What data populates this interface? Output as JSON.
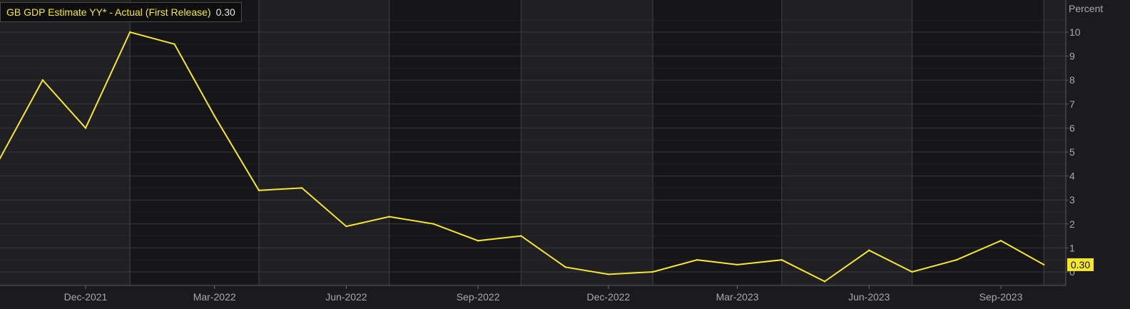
{
  "legend": {
    "series_label": "GB GDP Estimate YY* - Actual (First Release)",
    "last_value": "0.30"
  },
  "colors": {
    "background": "#1b1b1d",
    "band_light": "#202022",
    "band_dark": "#161618",
    "gridline": "#3a3a3d",
    "axis_text": "#a9a9ad",
    "series": "#f5e636"
  },
  "chart_data": {
    "type": "line",
    "title": "",
    "xlabel": "",
    "ylabel": "Percent",
    "ylim": [
      -0.7,
      11
    ],
    "y_ticks": [
      {
        "value": 10,
        "label": "10"
      },
      {
        "value": 9,
        "label": "9"
      },
      {
        "value": 8,
        "label": "8"
      },
      {
        "value": 7,
        "label": "7"
      },
      {
        "value": 6,
        "label": "6"
      },
      {
        "value": 5,
        "label": "5"
      },
      {
        "value": 4,
        "label": "4"
      },
      {
        "value": 3,
        "label": "3"
      },
      {
        "value": 2,
        "label": "2"
      },
      {
        "value": 1,
        "label": "1"
      },
      {
        "value": 0,
        "label": "0"
      }
    ],
    "x_ticks": [
      {
        "date": "2021-12-01",
        "label": "Dec-2021"
      },
      {
        "date": "2022-03-01",
        "label": "Mar-2022"
      },
      {
        "date": "2022-06-01",
        "label": "Jun-2022"
      },
      {
        "date": "2022-09-01",
        "label": "Sep-2022"
      },
      {
        "date": "2022-12-01",
        "label": "Dec-2022"
      },
      {
        "date": "2023-03-01",
        "label": "Mar-2023"
      },
      {
        "date": "2023-06-01",
        "label": "Jun-2023"
      },
      {
        "date": "2023-09-01",
        "label": "Sep-2023"
      }
    ],
    "grid": true,
    "legend_position": "top-left",
    "series": [
      {
        "name": "GB GDP Estimate YY* - Actual (First Release)",
        "last_value_label": "0.30",
        "points": [
          {
            "x": "2021-10-01",
            "y": 4.6
          },
          {
            "x": "2021-11-01",
            "y": 8.0
          },
          {
            "x": "2021-12-01",
            "y": 6.0
          },
          {
            "x": "2022-01-01",
            "y": 10.0
          },
          {
            "x": "2022-02-01",
            "y": 9.5
          },
          {
            "x": "2022-03-01",
            "y": 6.5
          },
          {
            "x": "2022-04-01",
            "y": 3.4
          },
          {
            "x": "2022-05-01",
            "y": 3.5
          },
          {
            "x": "2022-06-01",
            "y": 1.9
          },
          {
            "x": "2022-07-01",
            "y": 2.3
          },
          {
            "x": "2022-08-01",
            "y": 2.0
          },
          {
            "x": "2022-09-01",
            "y": 1.3
          },
          {
            "x": "2022-10-01",
            "y": 1.5
          },
          {
            "x": "2022-11-01",
            "y": 0.2
          },
          {
            "x": "2022-12-01",
            "y": -0.1
          },
          {
            "x": "2023-01-01",
            "y": 0.0
          },
          {
            "x": "2023-02-01",
            "y": 0.5
          },
          {
            "x": "2023-03-01",
            "y": 0.3
          },
          {
            "x": "2023-04-01",
            "y": 0.5
          },
          {
            "x": "2023-05-01",
            "y": -0.4
          },
          {
            "x": "2023-06-01",
            "y": 0.9
          },
          {
            "x": "2023-07-01",
            "y": 0.0
          },
          {
            "x": "2023-08-01",
            "y": 0.5
          },
          {
            "x": "2023-09-01",
            "y": 1.3
          },
          {
            "x": "2023-10-01",
            "y": 0.3
          }
        ]
      }
    ]
  }
}
